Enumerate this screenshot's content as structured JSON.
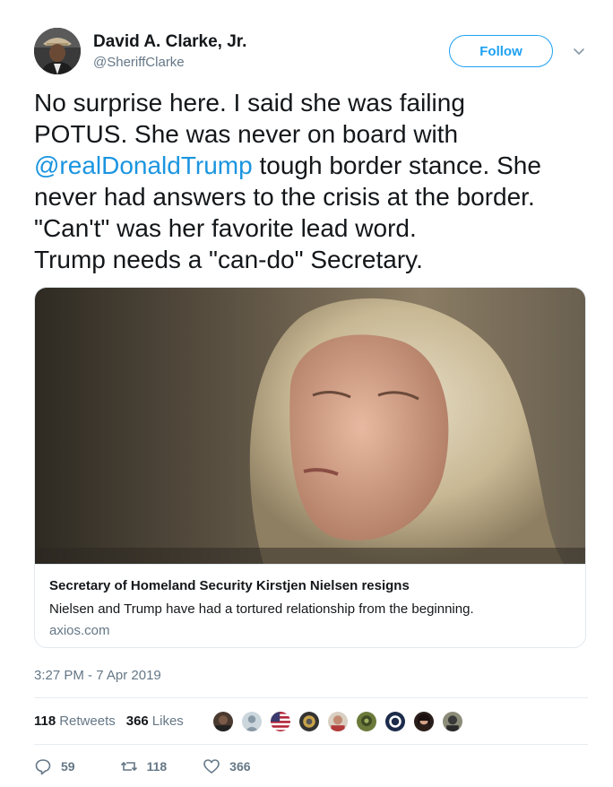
{
  "user": {
    "display_name": "David A. Clarke, Jr.",
    "handle": "@SheriffClarke",
    "avatar_icon": "avatar"
  },
  "follow_label": "Follow",
  "tweet": {
    "lines": [
      "No surprise here. I said she was failing",
      "POTUS. She was never on board with",
      "never had answers to the crisis at the border.",
      "\"Can't\" was her favorite lead word.",
      "Trump needs a \"can-do\" Secretary."
    ],
    "mention": "@realDonaldTrump",
    "mention_tail": " tough border stance. She"
  },
  "card": {
    "title": "Secretary of Homeland Security Kirstjen Nielsen resigns",
    "description": "Nielsen and Trump have had a tortured relationship from the beginning.",
    "domain": "axios.com"
  },
  "timestamp": "3:27 PM - 7 Apr 2019",
  "stats": {
    "retweets": "118",
    "retweets_label": "Retweets",
    "likes": "366",
    "likes_label": "Likes"
  },
  "actions": {
    "replies": "59",
    "retweets": "118",
    "likes": "366"
  },
  "colors": {
    "accent": "#1da1f2",
    "mention": "#1b95e0",
    "secondary_text": "#657786"
  }
}
